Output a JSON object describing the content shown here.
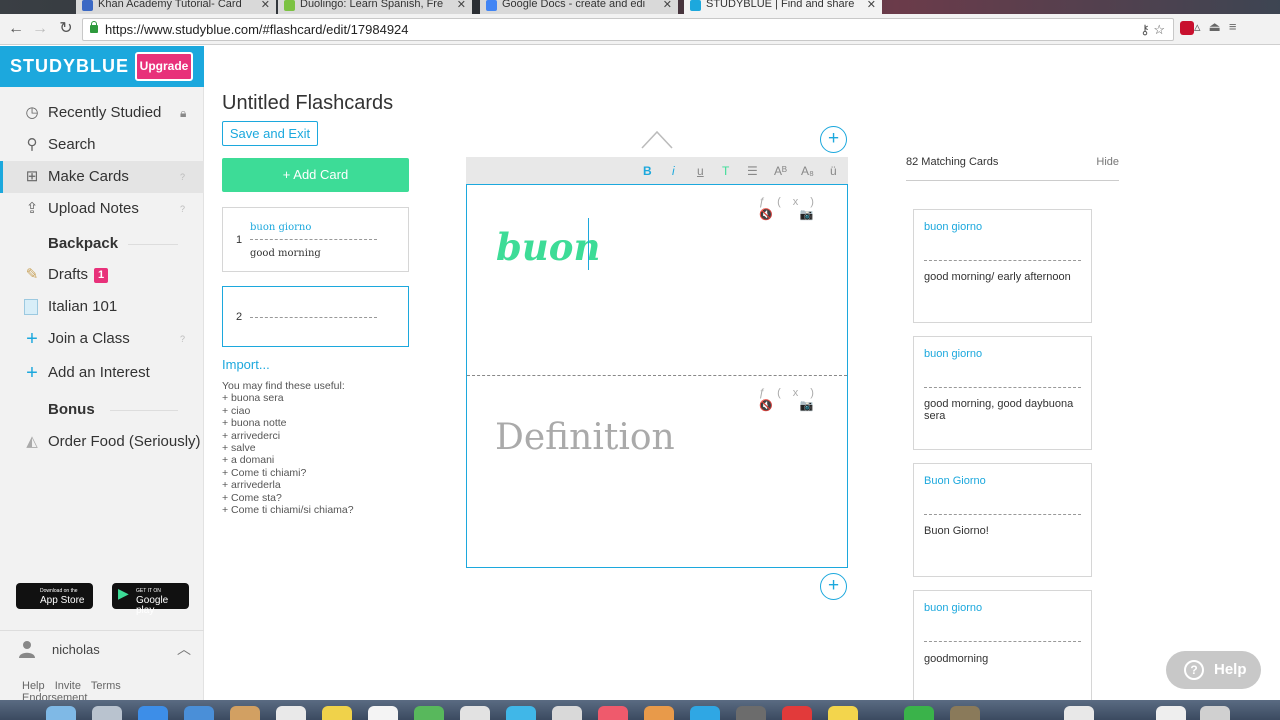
{
  "browser": {
    "tabs": [
      {
        "title": "Khan Academy Tutorial- Card",
        "color": "#3a68c4"
      },
      {
        "title": "Duolingo: Learn Spanish, Fre",
        "color": "#7cc243"
      },
      {
        "title": "Google Docs - create and edi",
        "color": "#4285f4"
      },
      {
        "title": "STUDYBLUE | Find and share",
        "color": "#1ca8dd"
      }
    ],
    "url": "https://www.studyblue.com/#flashcard/edit/17984924"
  },
  "sidebar": {
    "brand": "STUDYBLUE",
    "upgrade_label": "Upgrade",
    "items": [
      {
        "label": "Recently Studied"
      },
      {
        "label": "Search"
      },
      {
        "label": "Make Cards",
        "help": "?"
      },
      {
        "label": "Upload Notes",
        "help": "?"
      }
    ],
    "backpack_title": "Backpack",
    "backpack_items": [
      {
        "label": "Drafts",
        "badge": "1"
      },
      {
        "label": "Italian 101"
      },
      {
        "label": "Join a Class",
        "help": "?"
      },
      {
        "label": "Add an Interest"
      }
    ],
    "bonus_title": "Bonus",
    "bonus_items": [
      {
        "label": "Order Food (Seriously)"
      }
    ],
    "app_store": {
      "small": "Download on the",
      "label": "App Store"
    },
    "google_play": {
      "small": "GET IT ON",
      "label": "Google play"
    },
    "user_name": "nicholas",
    "footer_links": [
      "Help",
      "Invite",
      "Terms",
      "Endorsement"
    ]
  },
  "editor": {
    "deck_title": "Untitled Flashcards",
    "save_exit_label": "Save and Exit",
    "add_card_label": "+ Add Card",
    "cards": [
      {
        "number": "1",
        "term": "buon giorno",
        "definition": "good morning"
      },
      {
        "number": "2",
        "term": "",
        "definition": ""
      }
    ],
    "import_label": "Import...",
    "useful_title": "You may find these useful:",
    "useful_items": [
      "+ buona sera",
      "+ ciao",
      "+ buona notte",
      "+ arrivederci",
      "+ salve",
      "+ a domani",
      "+ Come ti chiami?",
      "+ arrivederla",
      "+ Come sta?",
      "+ Come ti chiami/si chiama?"
    ],
    "toolbar": {
      "bold": "B",
      "italic": "i",
      "underline": "u",
      "text": "T",
      "list": "☰",
      "superscript": "Aᴮ",
      "subscript": "A₈",
      "umlaut": "ü"
    },
    "side_tools": "ƒ(x) 🔇 📷",
    "term_text": "buon",
    "definition_placeholder": "Definition"
  },
  "matching": {
    "count_label": "82 Matching Cards",
    "hide_label": "Hide",
    "cards": [
      {
        "term": "buon giorno",
        "definition": "good morning/ early afternoon"
      },
      {
        "term": "buon giorno",
        "definition": "good morning, good daybuona sera"
      },
      {
        "term": "Buon Giorno",
        "definition": "Buon Giorno!"
      },
      {
        "term": "buon giorno",
        "definition": "goodmorning"
      }
    ]
  },
  "help_button_label": "Help",
  "colors": {
    "brand": "#1ca8dd",
    "accent_green": "#3ddc97",
    "upgrade_pink": "#e8317a"
  }
}
